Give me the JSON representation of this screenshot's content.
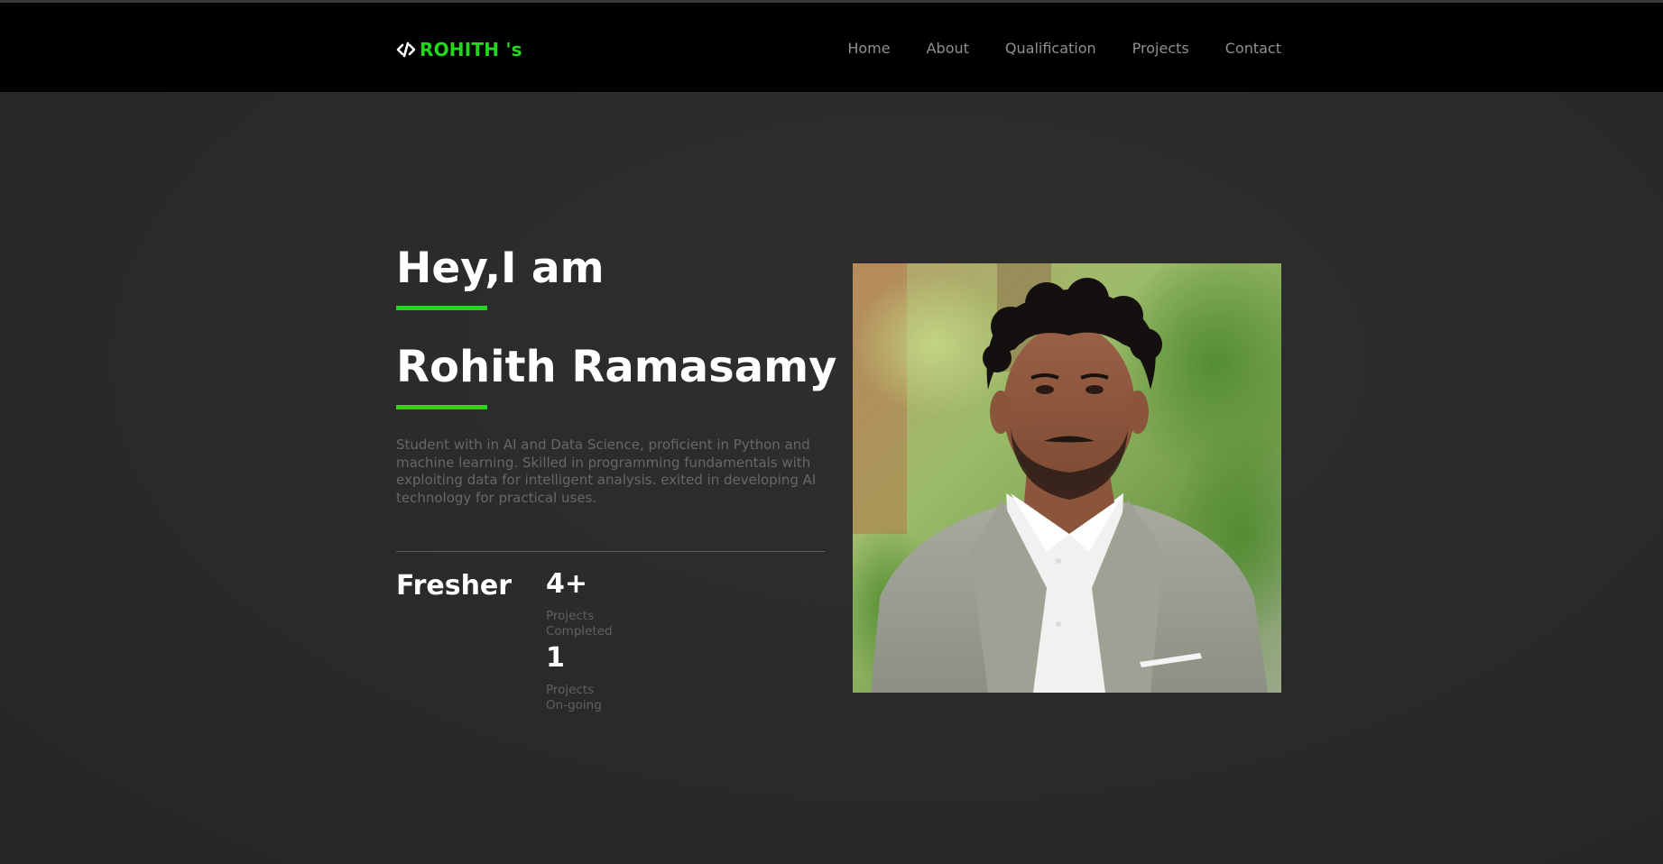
{
  "navbar": {
    "logo_text": "ROHITH 's",
    "logo_icon": "code-icon",
    "items": [
      {
        "label": "Home"
      },
      {
        "label": "About"
      },
      {
        "label": "Qualification"
      },
      {
        "label": "Projects"
      },
      {
        "label": "Contact"
      }
    ]
  },
  "hero": {
    "greeting": "Hey,I am",
    "name": "Rohith Ramasamy",
    "description": "Student with in AI and Data Science, proficient in Python and machine learning. Skilled in programming fundamentals with exploiting data for intelligent analysis. exited in developing AI technology for practical uses.",
    "status": "Fresher",
    "stats": [
      {
        "number": "4+",
        "label_line1": "Projects",
        "label_line2": "Completed"
      },
      {
        "number": "1",
        "label_line1": "Projects",
        "label_line2": "On-going"
      }
    ]
  },
  "colors": {
    "accent": "#22d81c",
    "navbar_bg": "#000000",
    "page_bg": "#2a2a2a",
    "nav_text": "#8f8f8f",
    "muted_text": "#676767"
  }
}
